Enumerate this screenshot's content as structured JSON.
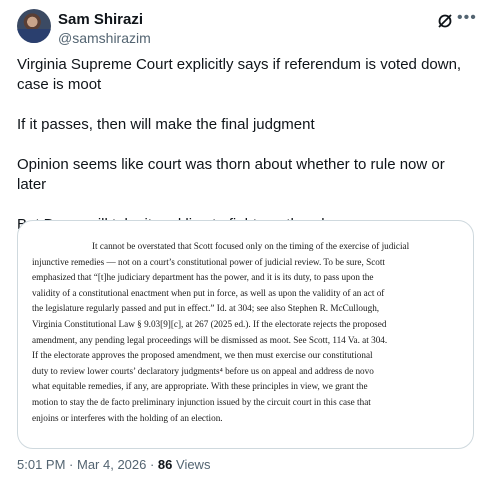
{
  "author": {
    "name": "Sam Shirazi",
    "handle": "@samshirazim"
  },
  "icons": {
    "avatar": "profile-photo",
    "grok": "grok-icon",
    "more": "more-icon"
  },
  "tweet": {
    "paragraphs": [
      "Virginia Supreme Court explicitly says if referendum is voted down, case is moot",
      "If it passes, then will make the final judgment",
      "Opinion seems like court was thorn about whether to rule now or later",
      "But Dems will take it and live to fight another day"
    ]
  },
  "document": {
    "lines": [
      "It cannot be overstated that Scott focused only on the timing of the exercise of judicial",
      "injunctive remedies — not on a court’s constitutional power of judicial review.  To be sure, Scott",
      "emphasized that “[t]he judiciary department has the power, and it is its duty, to pass upon the",
      "validity of a constitutional enactment when put in force, as well as upon the validity of an act of",
      "the legislature regularly passed and put in effect.”  Id. at 304; see also Stephen R. McCullough,",
      "Virginia Constitutional Law § 9.03[9][c], at 267 (2025 ed.).  If the electorate rejects the proposed",
      "amendment, any pending legal proceedings will be dismissed as moot.  See Scott, 114 Va. at 304.",
      "If the electorate approves the proposed amendment, we then must exercise our constitutional",
      "duty to review lower courts’ declaratory judgments⁴ before us on appeal and address de novo",
      "what equitable remedies, if any, are appropriate.  With these principles in view, we grant the",
      "motion to stay the de facto preliminary injunction issued by the circuit court in this case that",
      "enjoins or interferes with the holding of an election."
    ]
  },
  "meta": {
    "time": "5:01 PM",
    "separator": " · ",
    "date": "Mar 4, 2026",
    "views_count": "86",
    "views_label": " Views"
  }
}
